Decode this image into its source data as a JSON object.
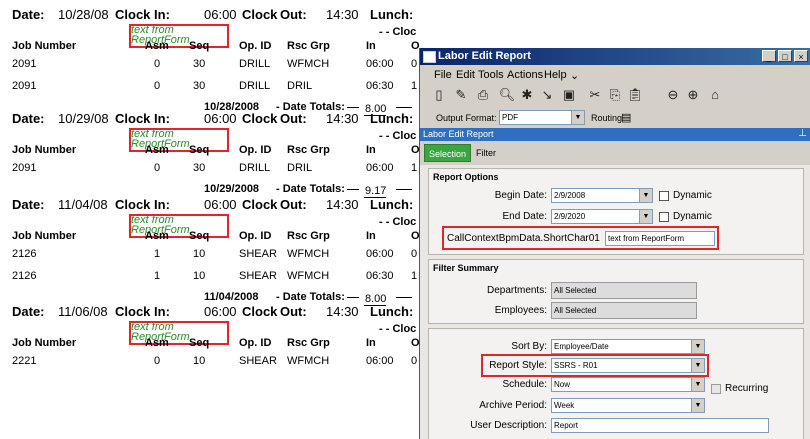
{
  "report": {
    "labels": {
      "date": "Date:",
      "clock_in": "Clock In:",
      "clock": "Clock",
      "out": "Out:",
      "lunch": "Lunch:",
      "job_number": "Job Number",
      "asm": "Asm",
      "seq": "Seq",
      "op_id": "Op. ID",
      "rsc_grp": "Rsc Grp",
      "in": "In",
      "o": "O",
      "clo": "- - Cloc",
      "note": "text from ReportForm",
      "date_totals": "- Date Totals:"
    },
    "sections": [
      {
        "date": "10/28/08",
        "clock_in": "06:00",
        "clock_out": "14:30",
        "rows": [
          {
            "job": "2091",
            "asm": "0",
            "seq": "30",
            "op": "DRILL",
            "rsc": "WFMCH",
            "in": "06:00",
            "o": "0"
          },
          {
            "job": "2091",
            "asm": "0",
            "seq": "30",
            "op": "DRILL",
            "rsc": "DRIL",
            "in": "06:30",
            "o": "1"
          }
        ],
        "total_date": "10/28/2008",
        "total": "8.00"
      },
      {
        "date": "10/29/08",
        "clock_in": "06:00",
        "clock_out": "14:30",
        "rows": [
          {
            "job": "2091",
            "asm": "0",
            "seq": "30",
            "op": "DRILL",
            "rsc": "DRIL",
            "in": "06:00",
            "o": "1"
          }
        ],
        "total_date": "10/29/2008",
        "total": "9.17"
      },
      {
        "date": "11/04/08",
        "clock_in": "06:00",
        "clock_out": "14:30",
        "rows": [
          {
            "job": "2126",
            "asm": "1",
            "seq": "10",
            "op": "SHEAR",
            "rsc": "WFMCH",
            "in": "06:00",
            "o": "0"
          },
          {
            "job": "2126",
            "asm": "1",
            "seq": "10",
            "op": "SHEAR",
            "rsc": "WFMCH",
            "in": "06:30",
            "o": "1"
          }
        ],
        "total_date": "11/04/2008",
        "total": "8.00"
      },
      {
        "date": "11/06/08",
        "clock_in": "06:00",
        "clock_out": "14:30",
        "rows": [
          {
            "job": "2221",
            "asm": "0",
            "seq": "10",
            "op": "SHEAR",
            "rsc": "WFMCH",
            "in": "06:00",
            "o": "0"
          }
        ]
      }
    ]
  },
  "window": {
    "title": "Labor Edit Report",
    "menu": [
      "File",
      "Edit",
      "Tools",
      "Actions",
      "Help"
    ],
    "output_format_label": "Output Format:",
    "output_format_value": "PDF",
    "routing_label": "Routing",
    "panel_title": "Labor Edit Report",
    "tabs": [
      "Selection",
      "Filter"
    ],
    "report_options": {
      "title": "Report Options",
      "begin_date_label": "Begin Date:",
      "begin_date": "2/9/2008",
      "end_date_label": "End Date:",
      "end_date": "2/9/2020",
      "dynamic_label": "Dynamic",
      "custom_label": "CallContextBpmData.ShortChar01",
      "custom_value": "text from ReportForm"
    },
    "filter_summary": {
      "title": "Filter Summary",
      "departments_label": "Departments:",
      "departments_value": "All Selected",
      "employees_label": "Employees:",
      "employees_value": "All Selected"
    },
    "options": {
      "sort_by_label": "Sort By:",
      "sort_by_value": "Employee/Date",
      "report_style_label": "Report Style:",
      "report_style_value": "SSRS - R01",
      "schedule_label": "Schedule:",
      "schedule_value": "Now",
      "recurring_label": "Recurring",
      "archive_label": "Archive Period:",
      "archive_value": "Week",
      "user_desc_label": "User Description:",
      "user_desc_value": "Report"
    }
  },
  "colors": {
    "highlight": "#e0262b",
    "title_bar": "#0a246a",
    "panel_header": "#2f6fc3",
    "note_text": "#2a8a2a",
    "selection_tab": "#3aa640"
  }
}
